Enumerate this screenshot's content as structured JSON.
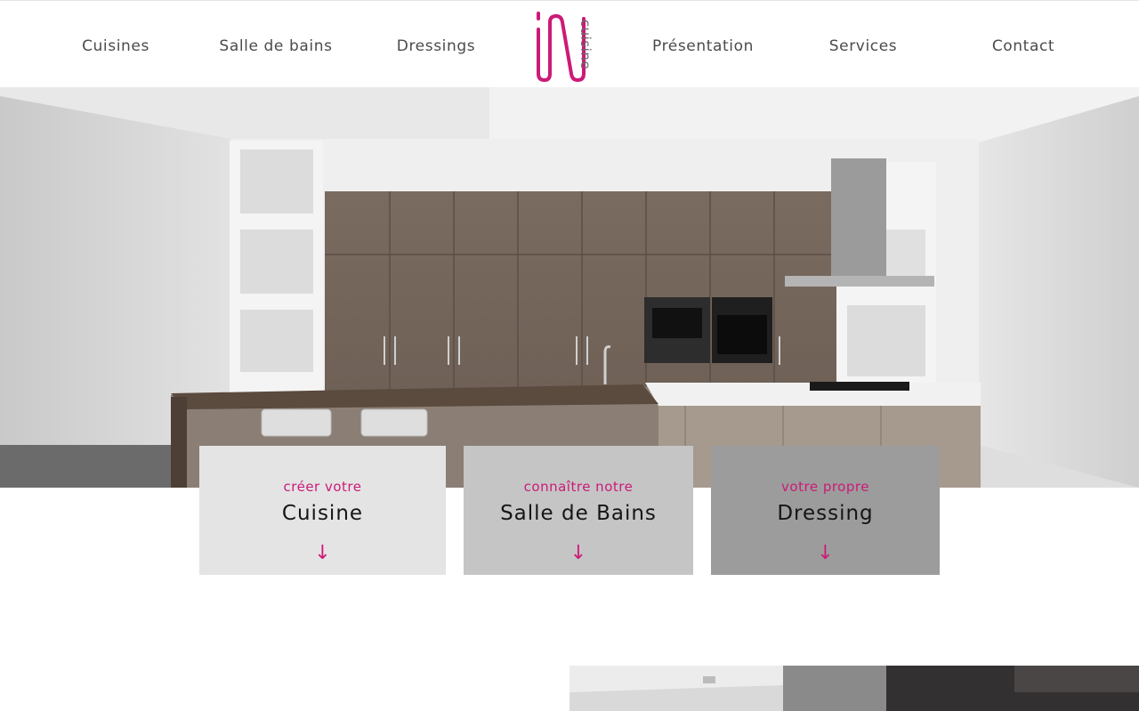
{
  "nav": {
    "items": [
      {
        "label": "Cuisines"
      },
      {
        "label": "Salle de bains"
      },
      {
        "label": "Dressings"
      },
      {
        "label": "Présentation"
      },
      {
        "label": "Services"
      },
      {
        "label": "Contact"
      }
    ]
  },
  "logo": {
    "mark": "iN",
    "word": "cuisine",
    "color": "#cc1a78"
  },
  "cards": [
    {
      "subtitle": "créer votre",
      "title": "Cuisine",
      "arrow": "↓"
    },
    {
      "subtitle": "connaître notre",
      "title": "Salle de Bains",
      "arrow": "↓"
    },
    {
      "subtitle": "votre propre",
      "title": "Dressing",
      "arrow": "↓"
    }
  ],
  "colors": {
    "accent": "#cc1a78",
    "card_light": "#e4e4e4",
    "card_mid": "#c5c5c5",
    "card_dark": "#9c9c9c"
  }
}
